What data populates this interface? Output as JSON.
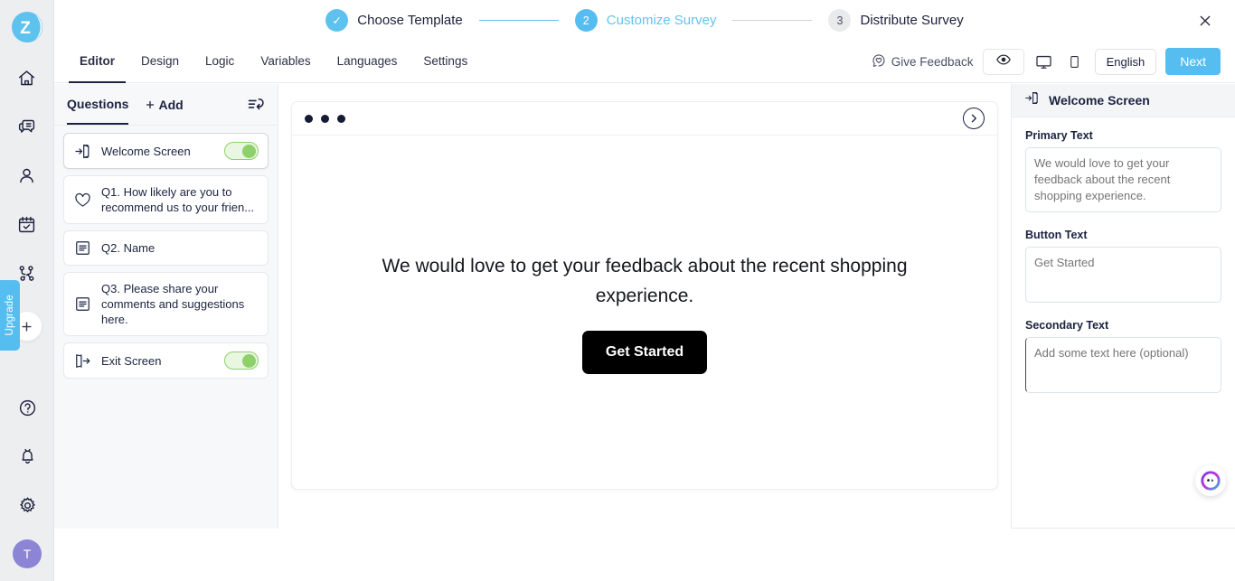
{
  "brand": {
    "logo_letter": "Z",
    "logo_color": "#5ec2ef"
  },
  "rail": {
    "items": [
      {
        "name": "home-icon",
        "label": "Home"
      },
      {
        "name": "feedback-icon",
        "label": "Feedback"
      },
      {
        "name": "contacts-icon",
        "label": "Contacts"
      },
      {
        "name": "surveys-icon",
        "label": "Surveys"
      },
      {
        "name": "workflow-icon",
        "label": "Workflow"
      }
    ],
    "add_label": "+",
    "upgrade_label": "Upgrade",
    "bottom_items": [
      {
        "name": "help-icon",
        "label": "Help"
      },
      {
        "name": "notification-icon",
        "label": "Notifications"
      },
      {
        "name": "settings-icon",
        "label": "Settings"
      }
    ],
    "avatar_initial": "T"
  },
  "stepper": {
    "steps": [
      {
        "badge": "✓",
        "label": "Choose Template",
        "state": "done"
      },
      {
        "badge": "2",
        "label": "Customize Survey",
        "state": "active"
      },
      {
        "badge": "3",
        "label": "Distribute Survey",
        "state": "idle"
      }
    ],
    "close_label": "✕",
    "active_color": "#63c3ef"
  },
  "tabbar": {
    "tabs": [
      {
        "label": "Editor",
        "active": true
      },
      {
        "label": "Design",
        "active": false
      },
      {
        "label": "Logic",
        "active": false
      },
      {
        "label": "Variables",
        "active": false
      },
      {
        "label": "Languages",
        "active": false
      },
      {
        "label": "Settings",
        "active": false
      }
    ],
    "give_feedback_label": "Give Feedback",
    "language_label": "English",
    "next_label": "Next",
    "next_color": "#56bdf0"
  },
  "questions_panel": {
    "title": "Questions",
    "add_label": "Add",
    "items": [
      {
        "icon": "enter-screen-icon",
        "text": "Welcome Screen",
        "toggle": true,
        "selected": true
      },
      {
        "icon": "heart-icon",
        "text": "Q1. How likely are you to recommend us to your frien...",
        "toggle": false,
        "selected": false
      },
      {
        "icon": "text-field-icon",
        "text": "Q2. Name",
        "toggle": false,
        "selected": false
      },
      {
        "icon": "text-field-icon",
        "text": "Q3. Please share your comments and suggestions here.",
        "toggle": false,
        "selected": false
      },
      {
        "icon": "exit-screen-icon",
        "text": "Exit Screen",
        "toggle": true,
        "selected": false
      }
    ],
    "toggle_color": "#8ed06a"
  },
  "preview": {
    "primary_text": "We would love to get your feedback about the recent shopping experience.",
    "button_text": "Get Started",
    "button_color": "#000000"
  },
  "right_panel": {
    "title": "Welcome Screen",
    "fields": [
      {
        "label": "Primary Text",
        "value": "",
        "placeholder": "We would love to get your feedback about the recent shopping experience."
      },
      {
        "label": "Button Text",
        "value": "",
        "placeholder": "Get Started"
      },
      {
        "label": "Secondary Text",
        "value": "",
        "placeholder": "Add some text here (optional)"
      }
    ]
  }
}
